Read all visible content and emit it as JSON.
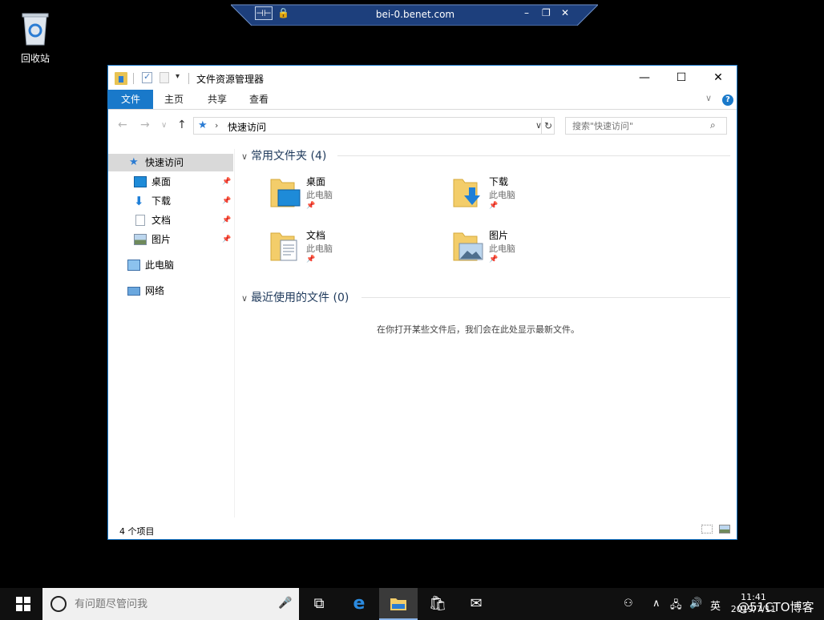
{
  "desktop": {
    "recycle_bin_label": "回收站"
  },
  "remote_bar": {
    "title": "bei-0.benet.com",
    "minimize": "–",
    "restore": "❐",
    "close": "✕"
  },
  "window": {
    "title": "文件资源管理器",
    "controls": {
      "minimize": "—",
      "maximize": "☐",
      "close": "✕"
    },
    "ribbon_tabs": [
      "文件",
      "主页",
      "共享",
      "查看"
    ],
    "help": "?",
    "address": {
      "location": "快速访问"
    },
    "search": {
      "placeholder": "搜索\"快速访问\""
    },
    "nav_items": [
      {
        "label": "快速访问",
        "icon": "star-icon",
        "selected": true
      },
      {
        "label": "桌面",
        "icon": "desktop-icon",
        "pinned": true
      },
      {
        "label": "下载",
        "icon": "download-icon",
        "pinned": true
      },
      {
        "label": "文档",
        "icon": "document-icon",
        "pinned": true
      },
      {
        "label": "图片",
        "icon": "picture-icon",
        "pinned": true
      },
      {
        "label": "此电脑",
        "icon": "computer-icon"
      },
      {
        "label": "网络",
        "icon": "network-icon"
      }
    ],
    "groups": {
      "frequent": {
        "heading": "常用文件夹 (4)",
        "folders": [
          {
            "name": "桌面",
            "location": "此电脑"
          },
          {
            "name": "下载",
            "location": "此电脑"
          },
          {
            "name": "文档",
            "location": "此电脑"
          },
          {
            "name": "图片",
            "location": "此电脑"
          }
        ]
      },
      "recent": {
        "heading": "最近使用的文件 (0)",
        "empty_message": "在你打开某些文件后，我们会在此处显示最新文件。"
      }
    },
    "status": {
      "item_count": "4 个项目"
    }
  },
  "taskbar": {
    "search_placeholder": "有问题尽管问我",
    "tray_lang": "英",
    "clock_time": "11:41",
    "clock_date": "2019/7/11"
  },
  "watermark": "@51CTO博客",
  "colors": {
    "accent": "#1979ca",
    "taskbar": "#101010",
    "folder": "#f3cd6a"
  }
}
